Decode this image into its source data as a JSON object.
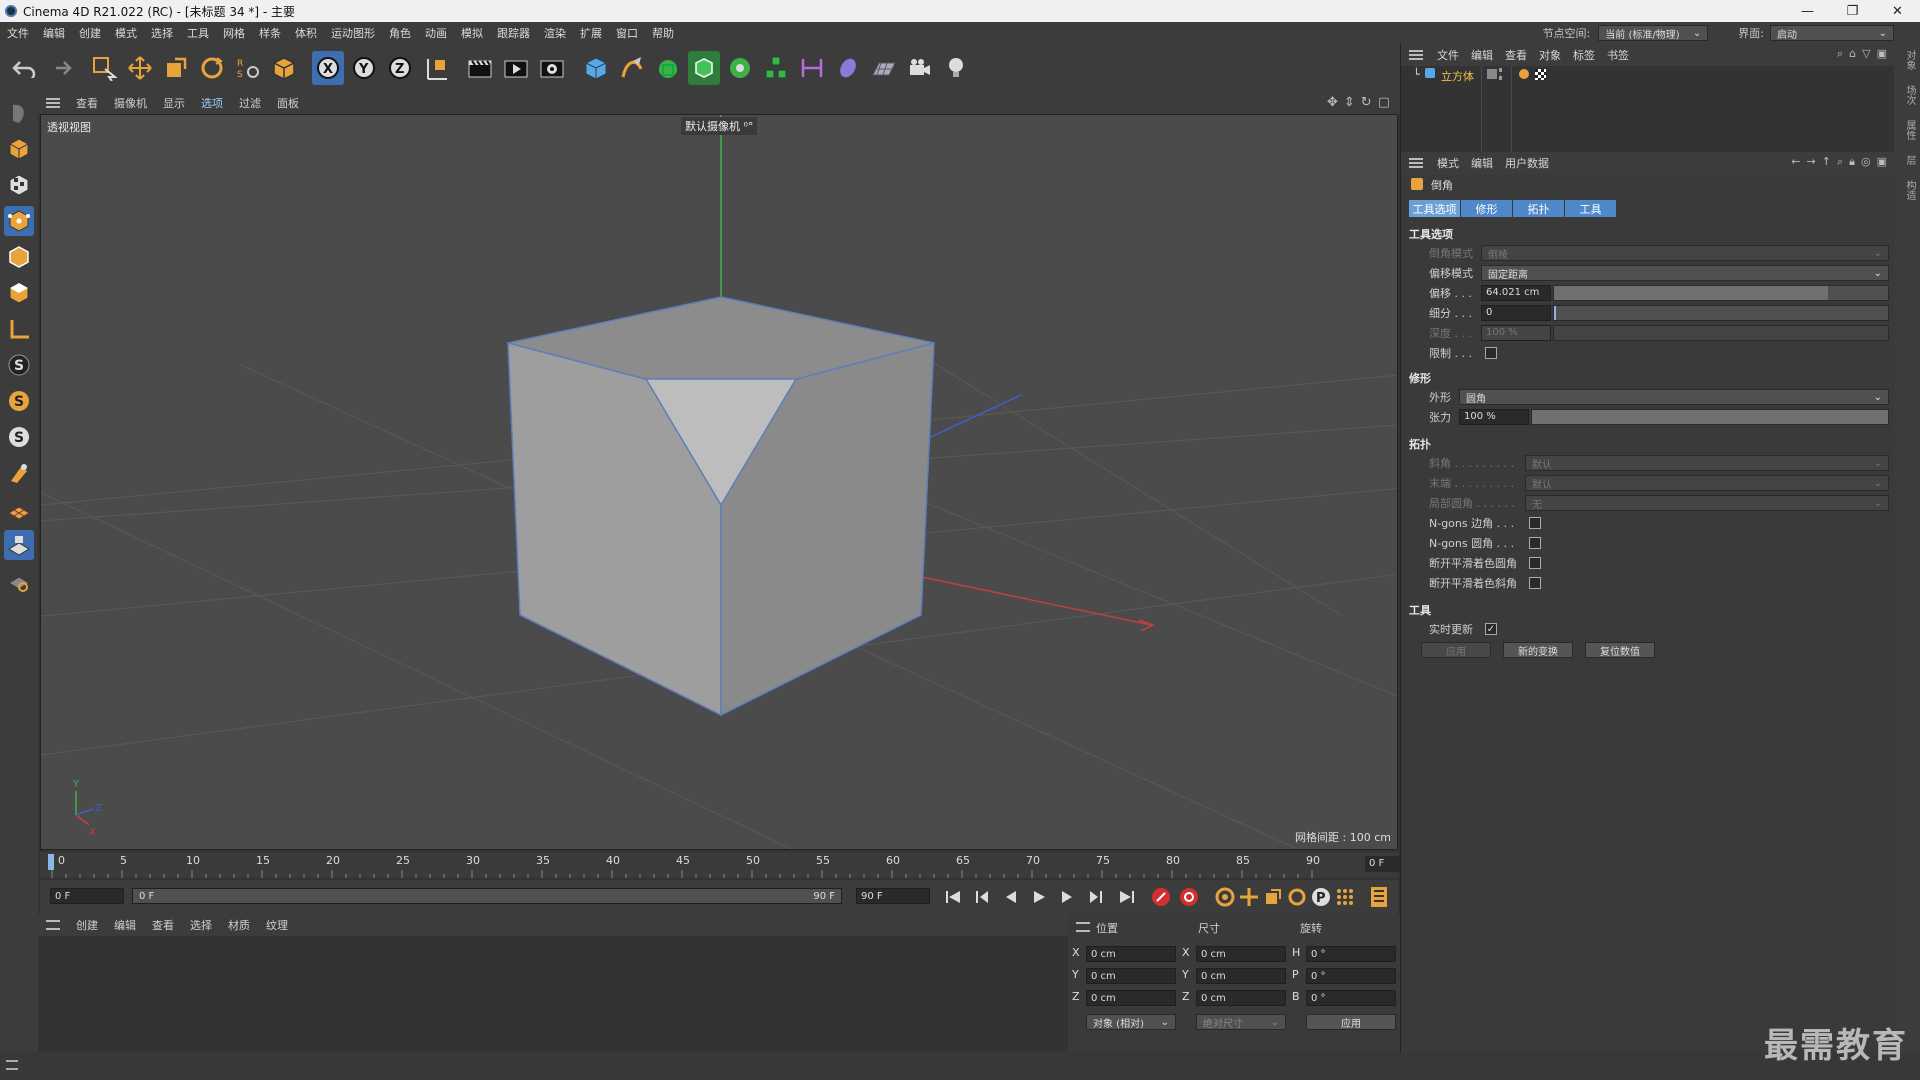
{
  "window": {
    "title": "Cinema 4D R21.022 (RC) - [未标题 34 *] - 主要",
    "controls": [
      "—",
      "❐",
      "✕"
    ]
  },
  "menu": {
    "items": [
      "文件",
      "编辑",
      "创建",
      "模式",
      "选择",
      "工具",
      "网格",
      "样条",
      "体积",
      "运动图形",
      "角色",
      "动画",
      "模拟",
      "跟踪器",
      "渲染",
      "扩展",
      "窗口",
      "帮助"
    ],
    "node_space_label": "节点空间:",
    "node_space_value": "当前 (标准/物理)",
    "layout_label": "界面:",
    "layout_value": "启动"
  },
  "toolbar": {
    "axis_x": "X",
    "axis_y": "Y",
    "axis_z": "Z"
  },
  "viewport": {
    "menu": [
      "查看",
      "摄像机",
      "显示",
      "选项",
      "过滤",
      "面板"
    ],
    "active_menu_index": 3,
    "view_label": "透视视图",
    "camera_label": "默认摄像机 ⁰°",
    "grid_spacing": "网格间距 : 100 cm",
    "axis_x": "X",
    "axis_y": "Y",
    "axis_z": "Z"
  },
  "timeline": {
    "ticks": [
      "0",
      "5",
      "10",
      "15",
      "20",
      "25",
      "30",
      "35",
      "40",
      "45",
      "50",
      "55",
      "60",
      "65",
      "70",
      "75",
      "80",
      "85",
      "90"
    ],
    "current_frame": "0 F"
  },
  "playback": {
    "start": "0 F",
    "range_start": "0 F",
    "range_end": "90 F",
    "end": "90 F"
  },
  "material_menu": [
    "创建",
    "编辑",
    "查看",
    "选择",
    "材质",
    "纹理"
  ],
  "coordinates": {
    "headers": [
      "位置",
      "尺寸",
      "旋转"
    ],
    "pos": [
      {
        "axis": "X",
        "value": "0 cm"
      },
      {
        "axis": "Y",
        "value": "0 cm"
      },
      {
        "axis": "Z",
        "value": "0 cm"
      }
    ],
    "size": [
      {
        "axis": "X",
        "value": "0 cm"
      },
      {
        "axis": "Y",
        "value": "0 cm"
      },
      {
        "axis": "Z",
        "value": "0 cm"
      }
    ],
    "rot": [
      {
        "axis": "H",
        "value": "0 °"
      },
      {
        "axis": "P",
        "value": "0 °"
      },
      {
        "axis": "B",
        "value": "0 °"
      }
    ],
    "mode_select": "对象 (相对)",
    "size_select": "绝对尺寸",
    "apply": "应用"
  },
  "object_manager": {
    "menu": [
      "文件",
      "编辑",
      "查看",
      "对象",
      "标签",
      "书签"
    ],
    "object_name": "立方体"
  },
  "attributes": {
    "menu": [
      "模式",
      "编辑",
      "用户数据"
    ],
    "tool_name": "倒角",
    "tabs": [
      "工具选项",
      "修形",
      "拓扑",
      "工具"
    ],
    "section_tool_options": "工具选项",
    "bevel_mode_label": "倒角模式",
    "bevel_mode_value": "倒棱",
    "offset_mode_label": "偏移模式",
    "offset_mode_value": "固定距离",
    "offset_label": "偏移 . . .",
    "offset_value": "64.021 cm",
    "offset_fraction": 0.82,
    "subdiv_label": "细分 . . .",
    "subdiv_value": "0",
    "depth_label": "深度 . . .",
    "depth_value": "100 %",
    "limit_label": "限制 . . .",
    "section_shaping": "修形",
    "shape_label": "外形",
    "shape_value": "圆角",
    "tension_label": "张力",
    "tension_value": "100 %",
    "tension_fraction": 1.0,
    "section_topology": "拓扑",
    "miter_label": "斜角 . . . . . . . . .",
    "miter_value": "默认",
    "end_label": "末端 . . . . . . . . .",
    "end_value": "默认",
    "partial_label": "局部圆角 . . . . . .",
    "partial_value": "无",
    "ngon_side_label": "N-gons 边角 . . .",
    "ngon_round_label": "N-gons 圆角 . . .",
    "break_phong_round_label": "断开平滑着色圆角",
    "break_phong_miter_label": "断开平滑着色斜角",
    "section_tool": "工具",
    "realtime_label": "实时更新",
    "realtime_checked": "✓",
    "btn_apply": "应用",
    "btn_new": "新的变换",
    "btn_reset": "复位数值"
  },
  "side_tabs": [
    "对象",
    "场次",
    "属性",
    "层",
    "构造"
  ],
  "watermark": "最需教育"
}
